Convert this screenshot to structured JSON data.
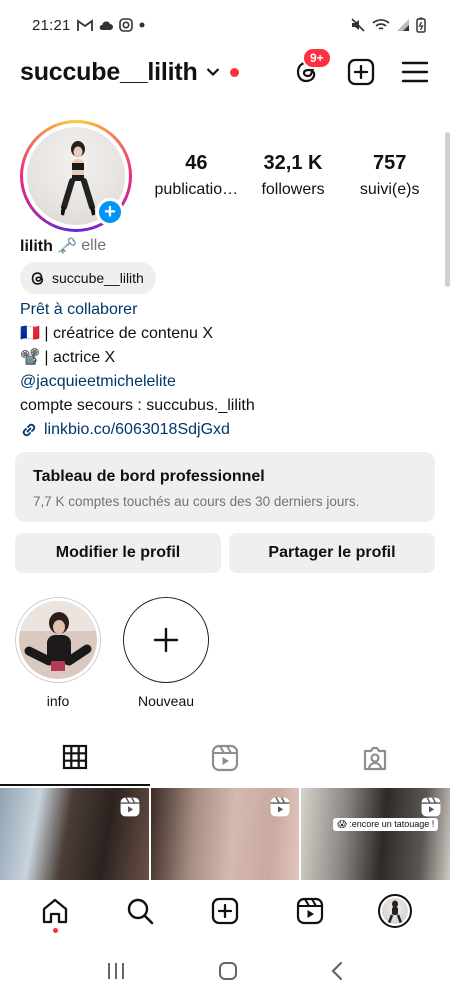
{
  "status_bar": {
    "time": "21:21",
    "left_icons": [
      "gmail-icon",
      "cloud-icon",
      "instagram-icon",
      "dot-icon"
    ],
    "right_icons": [
      "mute-icon",
      "wifi-icon",
      "signal-icon",
      "battery-icon"
    ]
  },
  "header": {
    "username": "succube__lilith",
    "threads_badge": "9+"
  },
  "profile": {
    "stats": [
      {
        "value": "46",
        "label": "publicatio…"
      },
      {
        "value": "32,1 K",
        "label": "followers"
      },
      {
        "value": "757",
        "label": "suivi(e)s"
      }
    ],
    "name": "lilith 🗝️",
    "pronoun": "elle",
    "threads_handle": "succube__lilith",
    "category": "Prêt à collaborer",
    "bio_lines": [
      "🇫🇷 | créatrice de contenu X",
      "📽️ | actrice X",
      "@jacquieetmichelelite",
      "compte secours : succubus._lilith"
    ],
    "link": "linkbio.co/6063018SdjGxd"
  },
  "dashboard": {
    "title": "Tableau de bord professionnel",
    "subtitle": "7,7 K comptes touchés au cours des 30 derniers jours."
  },
  "buttons": {
    "edit": "Modifier le profil",
    "share": "Partager le profil"
  },
  "highlights": [
    {
      "label": "info"
    },
    {
      "label": "Nouveau"
    }
  ],
  "grid": {
    "caption": "😱 :encore un tatouage !"
  },
  "colors": {
    "accent_blue": "#0095f6",
    "link_blue": "#00376b",
    "notification_red": "#ff3040",
    "button_gray": "#efefef"
  }
}
